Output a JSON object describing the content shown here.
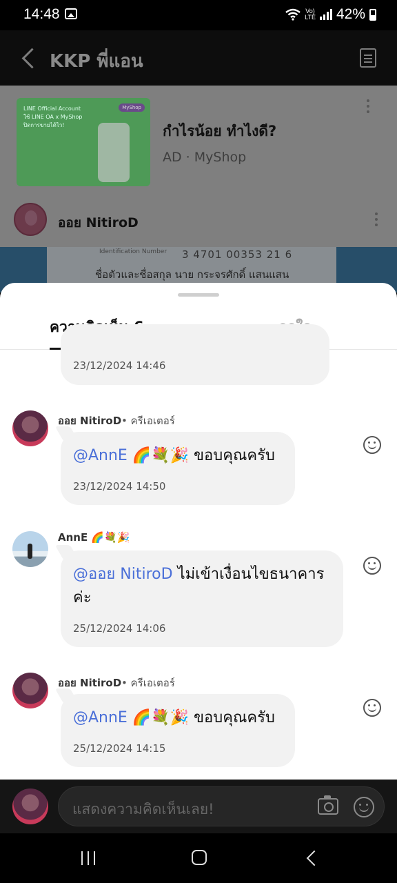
{
  "status_bar": {
    "time": "14:48",
    "lte_label": "Vo)\nLTE",
    "battery": "42%",
    "icons": [
      "image-icon",
      "wifi-icon",
      "signal-icon",
      "battery-icon"
    ]
  },
  "header": {
    "title": "KKP พี่แอน",
    "icons": [
      "back-arrow-icon",
      "document-icon"
    ]
  },
  "feed": {
    "ad": {
      "image_tag": "MyShop",
      "image_text": "LINE Official Account\nใช้ LINE OA x MyShop\nปิดการขายได้ไว!",
      "title": "กำไรน้อย ทำไงดี?",
      "meta": "AD · MyShop"
    },
    "post": {
      "author": "ออย NitiroD",
      "id_label": "Identification Number",
      "id_number": "3 4701 00353 21 6",
      "id_name": "ชื่อตัวและชื่อสกุล นาย กระจรศักดิ์ แสนแสน"
    }
  },
  "sheet": {
    "tabs": {
      "comments": "ความคิดเห็น 6",
      "likes": "ถูกใจ"
    },
    "partial_comment": {
      "timestamp": "23/12/2024 14:46"
    },
    "comments": [
      {
        "name": "ออย NitiroD",
        "role": "• ครีเอเตอร์",
        "mention": "@AnnE 🌈💐🎉",
        "text": " ขอบคุณครับ",
        "timestamp": "23/12/2024 14:50"
      },
      {
        "name": "AnnE 🌈💐🎉",
        "role": "",
        "mention": "@ออย NitiroD",
        "text": " ไม่เข้าเงื่อนไขธนาคาร",
        "text2": "ค่ะ",
        "timestamp": "25/12/2024 14:06"
      },
      {
        "name": "ออย NitiroD",
        "role": "• ครีเอเตอร์",
        "mention": "@AnnE 🌈💐🎉",
        "text": " ขอบคุณครับ",
        "timestamp": "25/12/2024 14:15"
      }
    ]
  },
  "input": {
    "placeholder": "แสดงความคิดเห็นเลย!"
  },
  "colors": {
    "mention": "#4a6fd8",
    "bubble": "#f2f2f2",
    "header_bg": "#0d0d0d"
  }
}
